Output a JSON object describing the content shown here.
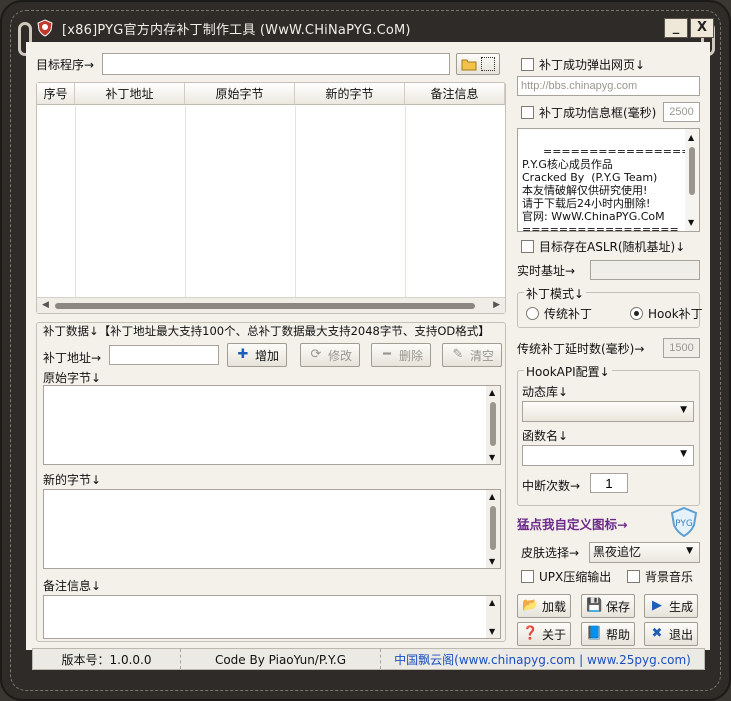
{
  "window": {
    "title": "[x86]PYG官方内存补丁制作工具 (WwW.CHiNaPYG.CoM)",
    "min_label": "_",
    "close_label": "X"
  },
  "target": {
    "label": "目标程序→",
    "value": "",
    "browse_icon": "folder-icon"
  },
  "table": {
    "columns": [
      "序号",
      "补丁地址",
      "原始字节",
      "新的字节",
      "备注信息"
    ],
    "rows": []
  },
  "patch_group": {
    "title": "补丁数据↓【补丁地址最大支持100个、总补丁数据最大支持2048字节、支持OD格式】",
    "address_label": "补丁地址→",
    "address_value": "",
    "add_label": "增加",
    "modify_label": "修改",
    "delete_label": "删除",
    "clear_label": "清空",
    "orig_label": "原始字节↓",
    "new_label": "新的字节↓",
    "note_label": "备注信息↓"
  },
  "right": {
    "popup_label": "补丁成功弹出网页↓",
    "popup_url": "http://bbs.chinapyg.com",
    "msgbox_label": "补丁成功信息框(毫秒)",
    "msgbox_ms": "2500",
    "info_text": "=================\nP.Y.G核心成员作品\nCracked By  (P.Y.G Team)\n本友情破解仅供研究使用!\n请于下载后24小时内删除!\n官网: WwW.ChinaPYG.CoM\n=================",
    "aslr_label": "目标存在ASLR(随机基址)↓",
    "base_label": "实时基址→",
    "base_value": "",
    "mode_group": "补丁模式↓",
    "mode_classic": "传统补丁",
    "mode_hook": "Hook补丁",
    "delay_label": "传统补丁延时数(毫秒)→",
    "delay_value": "1500",
    "hook_group": "HookAPI配置↓",
    "dll_label": "动态库↓",
    "dll_value": "",
    "func_label": "函数名↓",
    "func_value": "",
    "break_label": "中断次数→",
    "break_value": "1",
    "icon_label": "猛点我自定义图标→",
    "skin_label": "皮肤选择→",
    "skin_value": "黑夜追忆",
    "upx_label": "UPX压缩输出",
    "music_label": "背景音乐",
    "load_label": "加载",
    "save_label": "保存",
    "gen_label": "生成",
    "about_label": "关于",
    "help_label": "帮助",
    "exit_label": "退出"
  },
  "status": {
    "version": "版本号：1.0.0.0",
    "author": "Code By PiaoYun/P.Y.G",
    "site": "中国飘云阁(www.chinapyg.com | www.25pyg.com)"
  },
  "colors": {
    "frame": "#2e2b28",
    "panel": "#f4f1ea",
    "accent_purple": "#6b2a8a",
    "link_blue": "#1a4fc4"
  }
}
